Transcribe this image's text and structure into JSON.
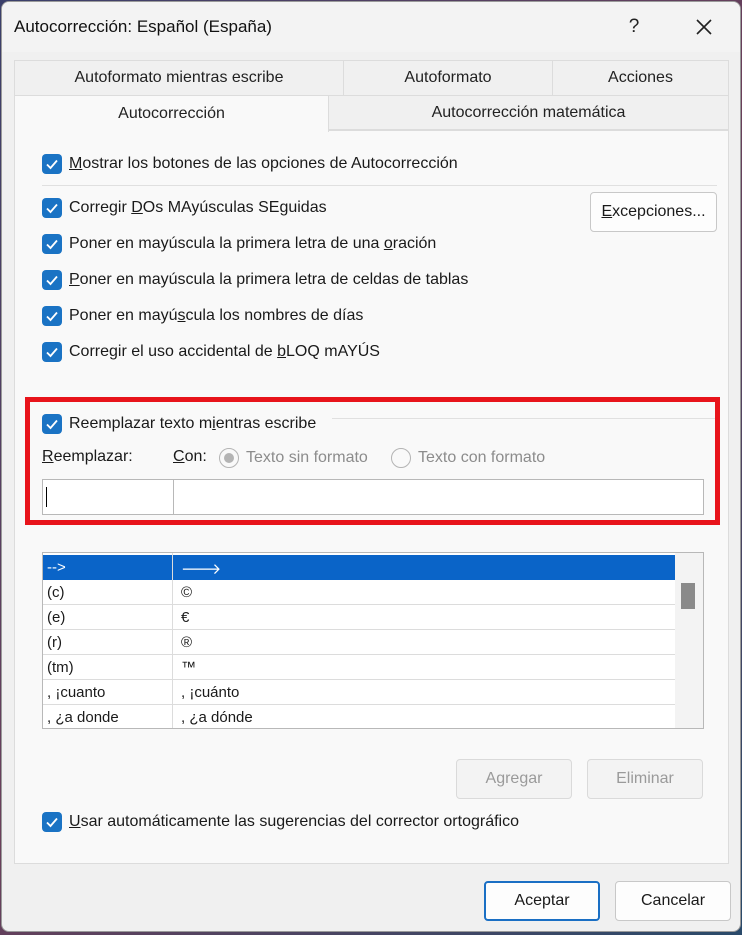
{
  "window": {
    "title": "Autocorrección: Español (España)",
    "help": "?",
    "close": "close"
  },
  "tabs": {
    "back": [
      "Autoformato mientras escribe",
      "Autoformato",
      "Acciones"
    ],
    "front": [
      "Autocorrección",
      "Autocorrección matemática"
    ]
  },
  "options": [
    {
      "pre": "",
      "u": "M",
      "post": "ostrar los botones de las opciones de Autocorrección",
      "checked": true
    },
    {
      "pre": "Corregir ",
      "u": "D",
      "post": "Os MAyúsculas SEguidas",
      "checked": true
    },
    {
      "pre": "Poner en mayúscula la primera letra de una ",
      "u": "o",
      "post": "ración",
      "checked": true
    },
    {
      "pre": "",
      "u": "P",
      "post": "oner en mayúscula la primera letra de celdas de tablas",
      "checked": true
    },
    {
      "pre": "Poner en mayú",
      "u": "s",
      "post": "cula los nombres de días",
      "checked": true
    },
    {
      "pre": "Corregir el uso accidental de ",
      "u": "b",
      "post": "LOQ mAYÚS",
      "checked": true
    }
  ],
  "exceptions_button": {
    "pre": "",
    "u": "E",
    "post": "xcepciones..."
  },
  "replace_section": {
    "checkbox": {
      "pre": "Reemplazar texto m",
      "u": "i",
      "post": "entras escribe",
      "checked": true
    },
    "replace_label": {
      "pre": "",
      "u": "R",
      "post": "eemplazar:"
    },
    "with_label": {
      "pre": "",
      "u": "C",
      "post": "on:"
    },
    "radio_plain": "Texto sin formato",
    "radio_formatted": "Texto con formato",
    "replace_value": "",
    "with_value": ""
  },
  "table": [
    {
      "from": "-->",
      "to": "🡒",
      "selected": true
    },
    {
      "from": "(c)",
      "to": "©"
    },
    {
      "from": "(e)",
      "to": "€"
    },
    {
      "from": "(r)",
      "to": "®"
    },
    {
      "from": "(tm)",
      "to": "™"
    },
    {
      "from": ", ¡cuanto",
      "to": ", ¡cuánto"
    },
    {
      "from": ", ¿a donde",
      "to": ", ¿a dónde"
    }
  ],
  "buttons": {
    "add": "Agregar",
    "delete": "Eliminar",
    "ok": "Aceptar",
    "cancel": "Cancelar"
  },
  "spell_option": {
    "pre": "",
    "u": "U",
    "post": "sar automáticamente las sugerencias del corrector ortográfico",
    "checked": true
  },
  "colors": {
    "accent": "#1a73c4",
    "selection": "#0a64c8",
    "highlight_border": "#e8141b"
  }
}
